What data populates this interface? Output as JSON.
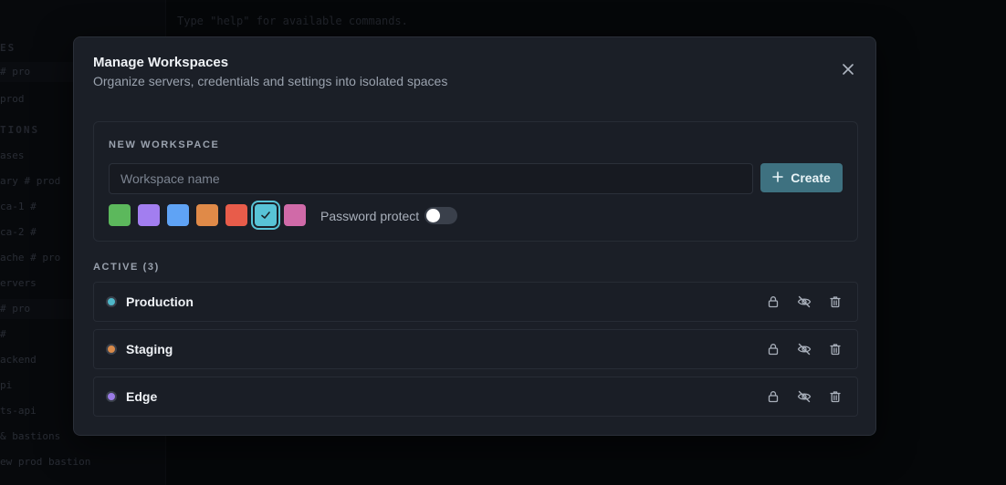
{
  "background": {
    "terminal_lines": [
      "",
      "Type \"help\" for available commands."
    ],
    "sidebar_lines": [
      {
        "text": "ES",
        "type": "section"
      },
      {
        "text": "  # pro",
        "type": "item"
      },
      {
        "text": "   prod",
        "type": "item"
      },
      {
        "text": "TIONS",
        "type": "section"
      },
      {
        "text": "ases",
        "type": "item"
      },
      {
        "text": "ary  # prod",
        "type": "item"
      },
      {
        "text": "ca-1   #",
        "type": "item"
      },
      {
        "text": "ca-2   #",
        "type": "item"
      },
      {
        "text": "ache  # pro",
        "type": "item"
      },
      {
        "text": "ervers",
        "type": "item"
      },
      {
        "text": "    # pro",
        "type": "item"
      },
      {
        "text": "       #",
        "type": "item"
      },
      {
        "text": "ackend",
        "type": "item"
      },
      {
        "text": "pi",
        "type": "item"
      },
      {
        "text": "ts-api",
        "type": "item"
      },
      {
        "text": "& bastions",
        "type": "item"
      },
      {
        "text": "ew   prod  bastion",
        "type": "item"
      }
    ]
  },
  "modal": {
    "title": "Manage Workspaces",
    "subtitle": "Organize servers, credentials and settings into isolated spaces",
    "close_icon": "close-icon"
  },
  "new_workspace": {
    "section_label": "NEW WORKSPACE",
    "name_placeholder": "Workspace name",
    "name_value": "",
    "create_label": "Create",
    "colors": [
      "#5cb85c",
      "#a27ef0",
      "#5fa3f5",
      "#e08a48",
      "#e85c4a",
      "#58c3d6",
      "#d06aa8"
    ],
    "selected_color_index": 5,
    "password_label": "Password protect",
    "password_enabled": false
  },
  "active": {
    "section_label": "ACTIVE (3)",
    "workspaces": [
      {
        "name": "Production",
        "color": "#4fb8c9"
      },
      {
        "name": "Staging",
        "color": "#d88a4a"
      },
      {
        "name": "Edge",
        "color": "#9a7be6"
      }
    ]
  }
}
